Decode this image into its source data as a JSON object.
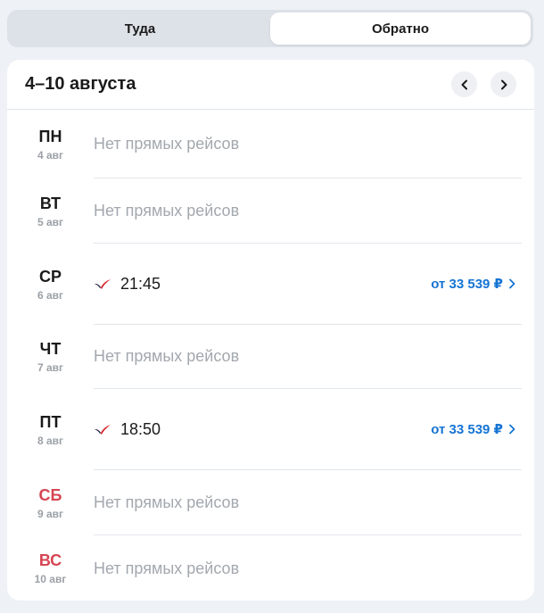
{
  "tabs": [
    {
      "label": "Туда",
      "active": false
    },
    {
      "label": "Обратно",
      "active": true
    }
  ],
  "week": {
    "title": "4–10 августа"
  },
  "icons": {
    "prev": "chevron-left-icon",
    "next": "chevron-right-icon",
    "airline": "airline-logo-icon"
  },
  "colors": {
    "weekend": "#d64552",
    "price": "#1574d4",
    "muted": "#a3a8ae"
  },
  "days": [
    {
      "dow": "ПН",
      "date": "4 авг",
      "status": "Нет прямых рейсов"
    },
    {
      "dow": "ВТ",
      "date": "5 авг",
      "status": "Нет прямых рейсов"
    },
    {
      "dow": "СР",
      "date": "6 авг",
      "time": "21:45",
      "price": "от 33 539 ₽"
    },
    {
      "dow": "ЧТ",
      "date": "7 авг",
      "status": "Нет прямых рейсов"
    },
    {
      "dow": "ПТ",
      "date": "8 авг",
      "time": "18:50",
      "price": "от 33 539 ₽"
    },
    {
      "dow": "СБ",
      "date": "9 авг",
      "status": "Нет прямых рейсов"
    },
    {
      "dow": "ВС",
      "date": "10 авг",
      "status": "Нет прямых рейсов"
    }
  ]
}
